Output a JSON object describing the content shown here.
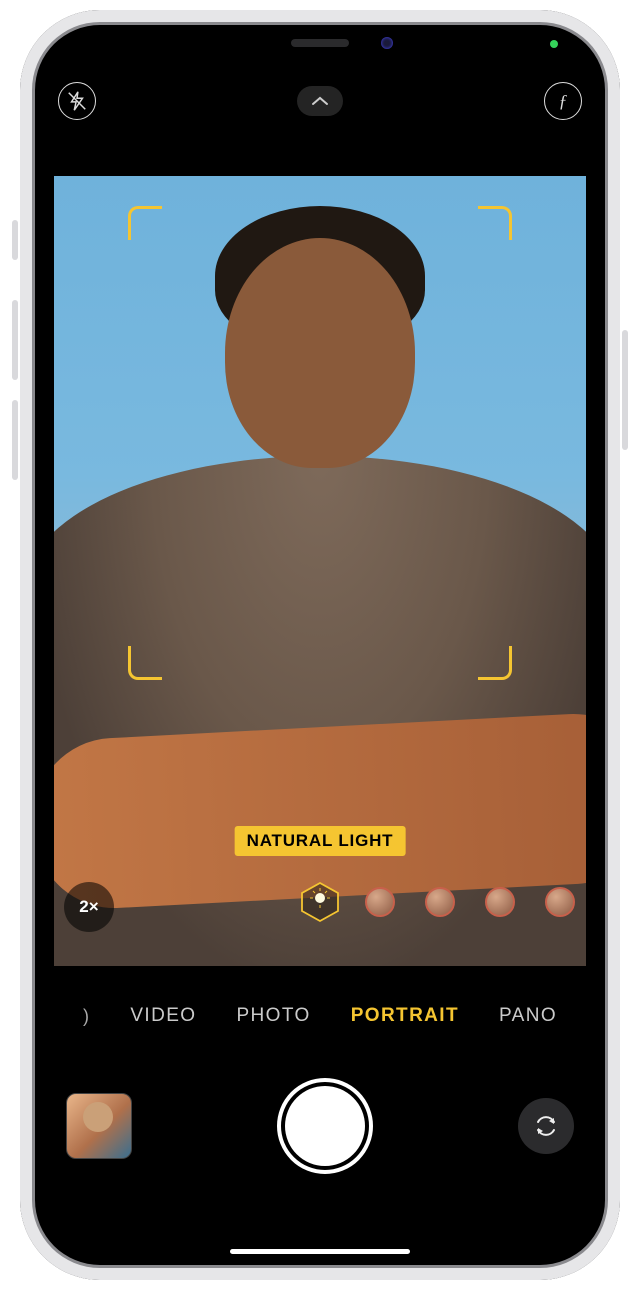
{
  "topbar": {
    "flash_state": "off",
    "aperture_symbol": "ƒ"
  },
  "viewfinder": {
    "lighting_label": "NATURAL LIGHT",
    "zoom_label": "2×",
    "lighting_options_visible": 5,
    "lighting_selected_index": 0
  },
  "modes": {
    "items": [
      "VIDEO",
      "PHOTO",
      "PORTRAIT",
      "PANO"
    ],
    "selected": "PORTRAIT"
  },
  "colors": {
    "accent": "#f5c531"
  }
}
